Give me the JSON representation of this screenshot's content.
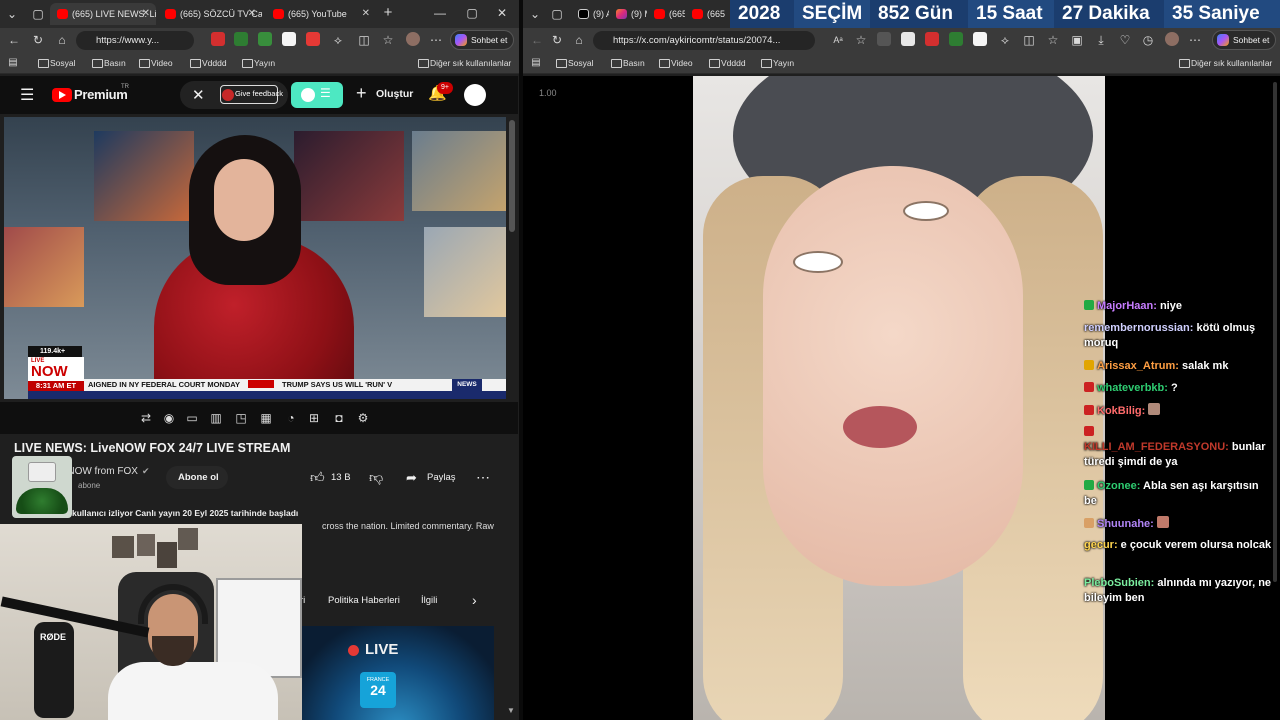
{
  "left_window": {
    "tabs": [
      {
        "label": "(665) LIVE NEWS: Li",
        "active": true
      },
      {
        "label": "(665) SÖZCÜ TV Ca",
        "active": false
      },
      {
        "label": "(665) YouTube",
        "active": false
      }
    ],
    "url": "https://www.y...",
    "copilot_label": "Sohbet et",
    "bookmarks": [
      "Sosyal",
      "Basın",
      "Video",
      "Vdddd",
      "Yayın"
    ],
    "other_bookmarks": "Diğer sık kullanılanlar"
  },
  "youtube": {
    "logo_text": "Premium",
    "logo_sup": "TR",
    "feedback_label": "Give feedback",
    "create_label": "Oluştur",
    "notif_count": "9+",
    "video": {
      "viewers": "119.4k+",
      "live_badge_top": "LIVE",
      "live_badge_main": "NOW",
      "time": "8:31 AM ET",
      "ticker_a": "AIGNED IN NY FEDERAL COURT MONDAY",
      "ticker_b": "TRUMP SAYS US WILL 'RUN' V",
      "ticker_tag": "NEWS"
    },
    "title": "LIVE NEWS: LiveNOW FOX 24/7 LIVE STREAM",
    "channel": "LiveNOW from FOX",
    "subscribers": "abone",
    "subscribe_label": "Abone ol",
    "likes": "13 B",
    "share_label": "Paylaş",
    "meta_line": "kullanıcı izliyor  Canlı yayın 20 Eyl 2025 tarihinde başladı",
    "desc_fragment": "cross the nation. Limited commentary. Raw",
    "chips": [
      "ri",
      "Politika Haberleri",
      "İlgili"
    ],
    "recommend_live_label": "LIVE",
    "recommend_channel_badge_top": "FRANCE",
    "recommend_channel_badge_num": "24"
  },
  "right_window": {
    "tabs": [
      {
        "label": "(9) A"
      },
      {
        "label": "(9) M"
      },
      {
        "label": "(665"
      },
      {
        "label": "(665"
      }
    ],
    "url": "https://x.com/aykiricomtr/status/20074...",
    "copilot_label": "Sohbet et",
    "bookmarks": [
      "Sosyal",
      "Basın",
      "Video",
      "Vdddd",
      "Yayın"
    ],
    "other_bookmarks": "Diğer sık kullanılanlar",
    "playback_speed": "1.00"
  },
  "countdown": {
    "year": "2028",
    "label": "SEÇİM",
    "days": "852 Gün",
    "hours": "15 Saat",
    "minutes": "27 Dakika",
    "seconds": "35 Saniye"
  },
  "chat": [
    {
      "user": "MajorHaan:",
      "msg": " niye",
      "color": "#c77dff",
      "badge": "#22aa44"
    },
    {
      "user": "remembernorussian:",
      "msg": " kötü olmuş moruq",
      "color": "#d0d0ff",
      "badge": ""
    },
    {
      "user": "Arissax_Atrum:",
      "msg": " salak mk",
      "color": "#ff9f43",
      "badge": "#e1a500"
    },
    {
      "user": "whateverbkb:",
      "msg": " ?",
      "color": "#2ecc71",
      "badge": "#cc2222"
    },
    {
      "user": "KokBilig:",
      "msg": " ",
      "color": "#ff6b6b",
      "badge": "#cc2222"
    },
    {
      "user": "KILLI_AM_FEDERASYONU:",
      "msg": " bunlar türedi şimdi de ya",
      "color": "#c0392b",
      "badge": "#cc2222"
    },
    {
      "user": "Ozonee:",
      "msg": " Abla sen aşı karşıtısın be",
      "color": "#2ecc71",
      "badge": "#22aa44"
    },
    {
      "user": "Shuunahe:",
      "msg": " ",
      "color": "#b084f5",
      "badge": "#d9a066"
    },
    {
      "user": "gecur:",
      "msg": " e çocuk verem olursa nolcak",
      "color": "#ffd54f",
      "badge": ""
    },
    {
      "user": "PleboSubien:",
      "msg": " alnında mı yazıyor, ne bileyim ben",
      "color": "#7bed9f",
      "badge": ""
    }
  ],
  "webcam": {
    "mic_brand": "RØDE"
  }
}
